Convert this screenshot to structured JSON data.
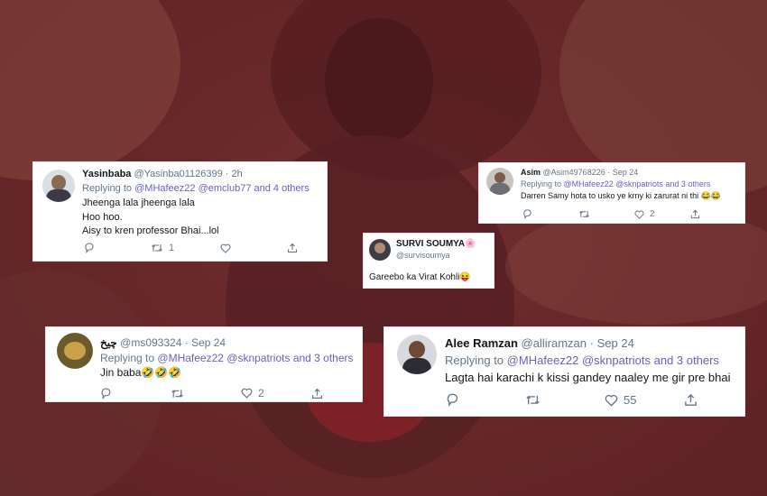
{
  "colors": {
    "tint": "#8c232d",
    "mention": "#6b5fbf",
    "muted": "#657786",
    "text": "#14171a"
  },
  "tweets": [
    {
      "name": "Yasinbaba",
      "handle": "@Yasinba01126399",
      "time": "2h",
      "replying_prefix": "Replying to",
      "mentions": "@MHafeez22 @emclub77 and 4 others",
      "lines": [
        "Jheenga lala jheenga lala",
        "Hoo hoo.",
        "Aisy to kren professor Bhai...lol"
      ],
      "actions": {
        "reply_icon": "reply-icon",
        "retweet_icon": "retweet-icon",
        "retweet_count": "1",
        "like_icon": "heart-icon",
        "like_count": "",
        "share_icon": "share-icon"
      }
    },
    {
      "name": "Asim",
      "handle": "@Asim49768226",
      "time": "Sep 24",
      "replying_prefix": "Replying to",
      "mentions": "@MHafeez22 @sknpatriots and 3 others",
      "lines": [
        "Darren Samy hota to usko ye krny ki zarurat ni thi 😂😂"
      ],
      "actions": {
        "retweet_count": "",
        "like_count": "2"
      }
    },
    {
      "name": "SURVI SOUMYA",
      "name_emoji": "🌸",
      "handle": "@survisoumya",
      "lines": [
        "Gareebo ka Virat Kohli😝"
      ]
    },
    {
      "name": "چیخ",
      "handle": "@ms093324",
      "time": "Sep 24",
      "replying_prefix": "Replying to",
      "mentions": "@MHafeez22 @sknpatriots and 3 others",
      "lines": [
        "Jin baba🤣🤣🤣"
      ],
      "actions": {
        "retweet_count": "",
        "like_count": "2"
      }
    },
    {
      "name": "Alee Ramzan",
      "handle": "@alliramzan",
      "time": "Sep 24",
      "replying_prefix": "Replying to",
      "mentions": "@MHafeez22 @sknpatriots and 3 others",
      "lines": [
        "Lagta hai karachi k kissi gandey naaley me gir pre bhai"
      ],
      "actions": {
        "retweet_count": "",
        "like_count": "55"
      }
    }
  ]
}
